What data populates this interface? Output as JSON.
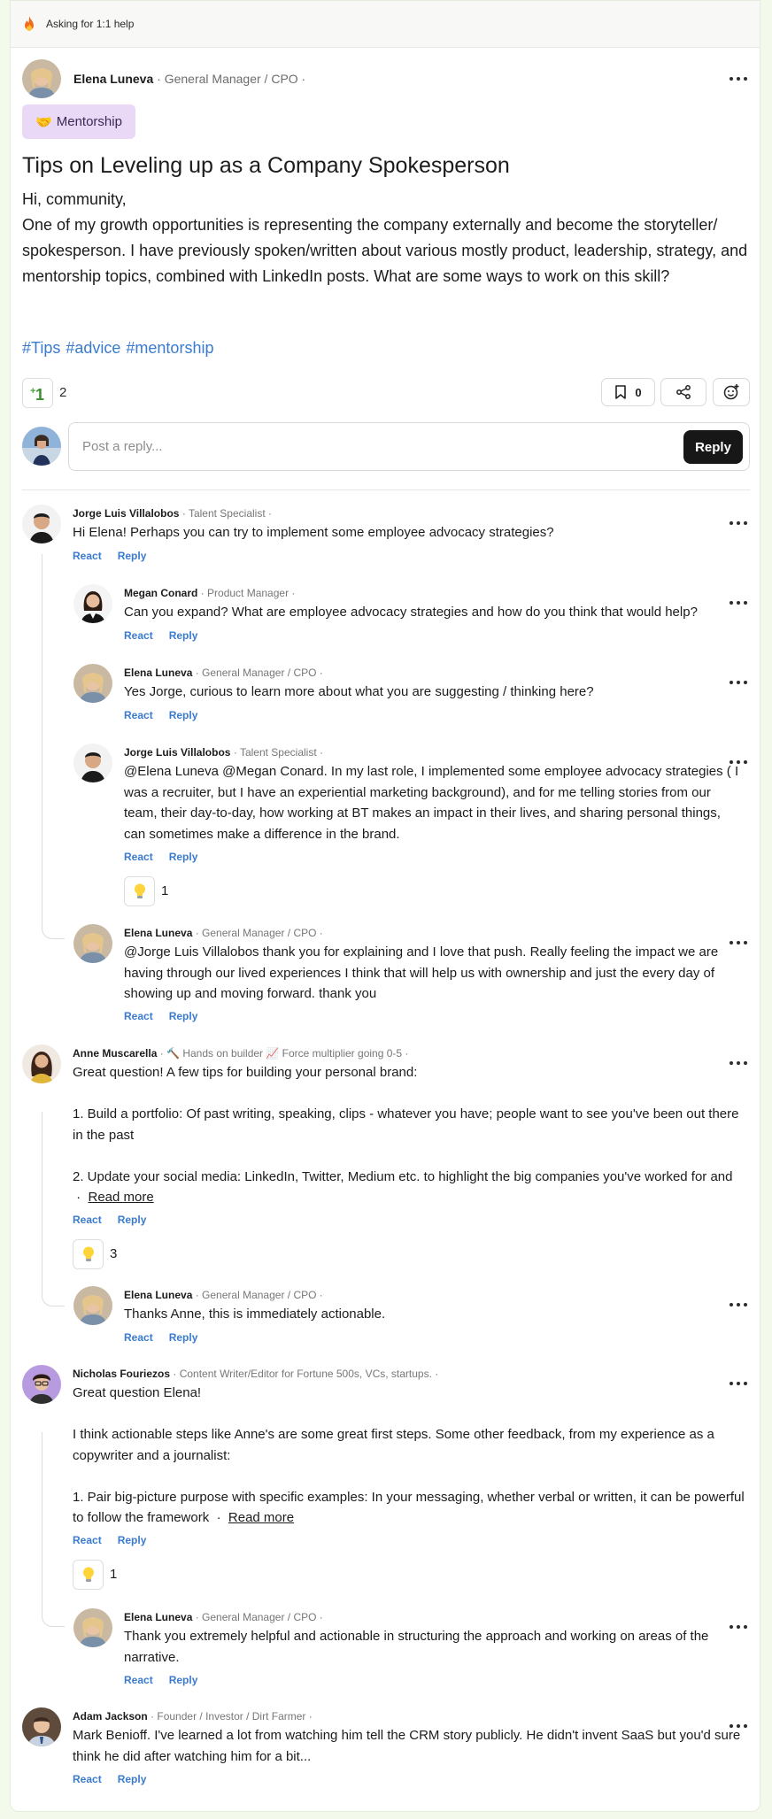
{
  "topbar": {
    "label": "Asking for 1:1 help"
  },
  "post": {
    "author": "Elena Luneva",
    "role": "· General Manager / CPO ·",
    "tag": "Mentorship",
    "title": "Tips on Leveling up as a Company Spokesperson",
    "body_line1": "Hi, community,",
    "body_line2": "One of my growth opportunities is representing the company externally and become the storyteller/ spokesperson. I have previously spoken/written about various mostly product, leadership, strategy, and mentorship topics, combined with LinkedIn posts. What are some ways to work on this skill?",
    "hashtags": [
      "#Tips",
      "#advice",
      "#mentorship"
    ],
    "upvotes": "2",
    "bookmarks": "0"
  },
  "reply_box": {
    "placeholder": "Post a reply...",
    "button": "Reply"
  },
  "actions": {
    "react": "React",
    "reply": "Reply",
    "read_more": "Read more"
  },
  "comments": [
    {
      "author": "Jorge Luis Villalobos",
      "role": "· Talent Specialist ·",
      "text": "Hi Elena! Perhaps you can try to implement some employee advocacy strategies?"
    },
    {
      "author": "Megan Conard",
      "role": "· Product Manager ·",
      "text": "Can you expand? What are employee advocacy strategies and how do you think that would help?"
    },
    {
      "author": "Elena Luneva",
      "role": "· General Manager / CPO ·",
      "text": "Yes Jorge, curious to learn more about what you are suggesting / thinking here?"
    },
    {
      "author": "Jorge Luis Villalobos",
      "role": "· Talent Specialist ·",
      "text": "@Elena Luneva @Megan Conard. In my last role, I implemented some employee advocacy strategies ( I was a recruiter, but I have an experiential marketing background), and for me telling stories from our team, their day-to-day, how working at BT makes an impact in their lives, and sharing personal things, can sometimes make a difference in the brand.",
      "reactions": "1"
    },
    {
      "author": "Elena Luneva",
      "role": "· General Manager / CPO ·",
      "text": "@Jorge Luis Villalobos thank you for explaining and I love that push. Really feeling the impact we are having through our lived experiences I think that will help us with ownership and just the every day of showing up and moving forward. thank you"
    },
    {
      "author": "Anne Muscarella",
      "role": "· 🔨 Hands on builder 📈 Force multiplier going 0-5 · ",
      "text_p1": "Great question! A few tips for building your personal brand:",
      "text_p2": "1. Build a portfolio: Of past writing, speaking, clips - whatever you have; people want to see you've been out there in the past",
      "text_p3": "2. Update your social media: LinkedIn, Twitter, Medium etc. to highlight the big companies you've worked for and",
      "reactions": "3"
    },
    {
      "author": "Elena Luneva",
      "role": "· General Manager / CPO ·",
      "text": "Thanks Anne, this is immediately actionable."
    },
    {
      "author": "Nicholas Fouriezos",
      "role": "· Content Writer/Editor for Fortune 500s, VCs, startups. ·",
      "text_p1": "Great question Elena!",
      "text_p2": "I think actionable steps like Anne's are some great first steps. Some other feedback, from my experience as a copywriter and a journalist:",
      "text_p3": "1. Pair big-picture purpose with specific examples: In your messaging, whether verbal or written, it can be powerful to follow the framework",
      "reactions": "1"
    },
    {
      "author": "Elena Luneva",
      "role": "· General Manager / CPO ·",
      "text": "Thank you extremely helpful and actionable in structuring the approach and working on areas of the narrative."
    },
    {
      "author": "Adam Jackson",
      "role": "· Founder / Investor / Dirt Farmer ·",
      "text": "Mark Benioff. I've learned a lot from watching him tell the CRM story publicly. He didn't invent SaaS but you'd sure think he did after watching him for a bit..."
    }
  ]
}
